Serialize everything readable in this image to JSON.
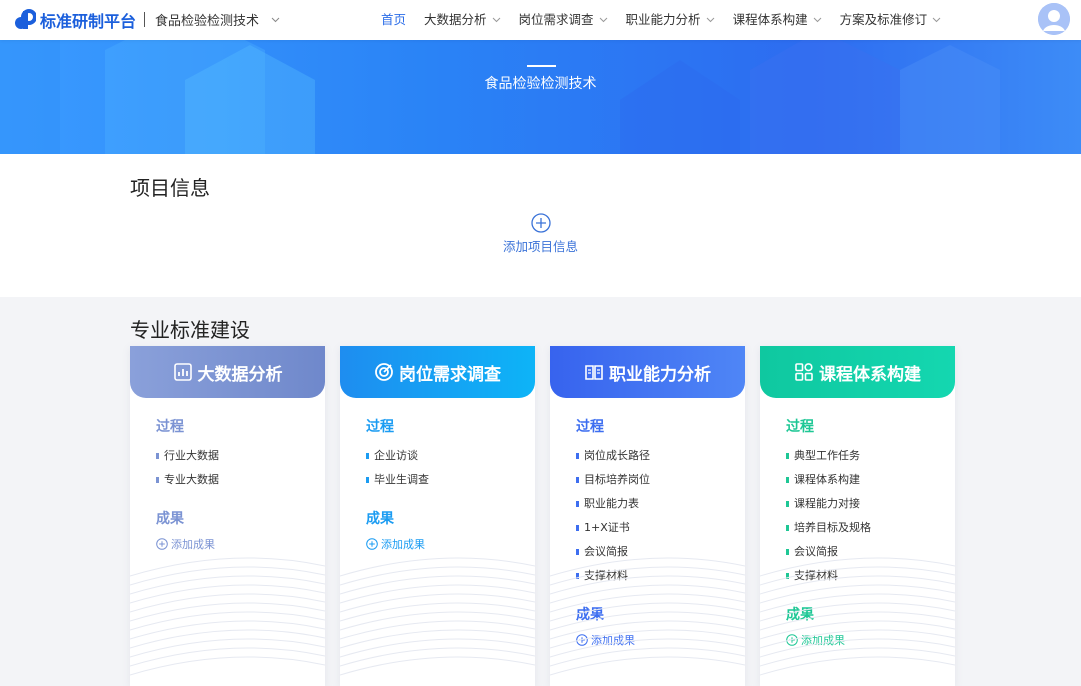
{
  "header": {
    "logo_text": "标准研制平台",
    "project_name": "食品检验检测技术",
    "nav": [
      {
        "label": "首页",
        "active": true,
        "has_dropdown": false
      },
      {
        "label": "大数据分析",
        "active": false,
        "has_dropdown": true
      },
      {
        "label": "岗位需求调查",
        "active": false,
        "has_dropdown": true
      },
      {
        "label": "职业能力分析",
        "active": false,
        "has_dropdown": true
      },
      {
        "label": "课程体系构建",
        "active": false,
        "has_dropdown": true
      },
      {
        "label": "方案及标准修订",
        "active": false,
        "has_dropdown": true
      }
    ]
  },
  "banner": {
    "title": "食品检验检测技术"
  },
  "project_info": {
    "title": "项目信息",
    "add_label": "添加项目信息"
  },
  "standards": {
    "title": "专业标准建设",
    "cards": [
      {
        "title": "大数据分析",
        "icon": "bar-chart-icon",
        "color": "#7b93d3",
        "head_gradient": [
          "#8aa0da",
          "#6f88cb"
        ],
        "process_label": "过程",
        "process": [
          "行业大数据",
          "专业大数据"
        ],
        "results_label": "成果",
        "add_result": "添加成果"
      },
      {
        "title": "岗位需求调查",
        "icon": "target-icon",
        "color": "#1b9cf2",
        "head_gradient": [
          "#1e8df0",
          "#0db4f7"
        ],
        "process_label": "过程",
        "process": [
          "企业访谈",
          "毕业生调查"
        ],
        "results_label": "成果",
        "add_result": "添加成果"
      },
      {
        "title": "职业能力分析",
        "icon": "book-icon",
        "color": "#3d6ef0",
        "head_gradient": [
          "#3763ee",
          "#4f86f6"
        ],
        "process_label": "过程",
        "process": [
          "岗位成长路径",
          "目标培养岗位",
          "职业能力表",
          "1+X证书",
          "会议简报",
          "支撑材料"
        ],
        "results_label": "成果",
        "add_result": "添加成果"
      },
      {
        "title": "课程体系构建",
        "icon": "grid-icon",
        "color": "#1ec795",
        "head_gradient": [
          "#0fc8a0",
          "#14d7b0"
        ],
        "process_label": "过程",
        "process": [
          "典型工作任务",
          "课程体系构建",
          "课程能力对接",
          "培养目标及规格",
          "会议简报",
          "支撑材料"
        ],
        "results_label": "成果",
        "add_result": "添加成果"
      }
    ]
  }
}
